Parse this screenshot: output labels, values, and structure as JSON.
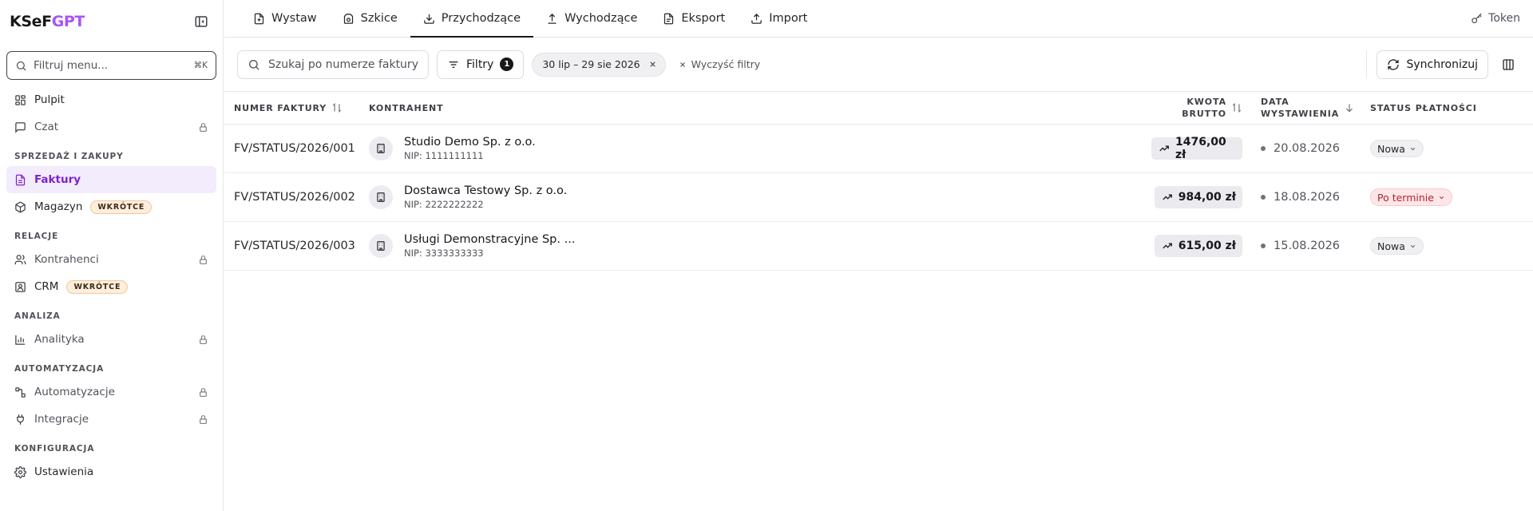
{
  "app": {
    "logo_part1": "KSeF",
    "logo_part2": "GPT"
  },
  "sidebar": {
    "filter_placeholder": "Filtruj menu...",
    "filter_shortcut": "⌘K",
    "items": [
      {
        "label": "Pulpit",
        "icon": "dashboard-icon"
      },
      {
        "label": "Czat",
        "icon": "chat-icon",
        "locked": true
      },
      {
        "label": "Faktury",
        "icon": "invoice-icon",
        "active": true
      },
      {
        "label": "Magazyn",
        "icon": "box-icon",
        "badge": "WKRÓTCE"
      },
      {
        "label": "Kontrahenci",
        "icon": "users-icon",
        "locked": true
      },
      {
        "label": "CRM",
        "icon": "contact-icon",
        "badge": "WKRÓTCE"
      },
      {
        "label": "Analityka",
        "icon": "chart-icon",
        "locked": true
      },
      {
        "label": "Automatyzacje",
        "icon": "workflow-icon",
        "locked": true
      },
      {
        "label": "Integracje",
        "icon": "plug-icon",
        "locked": true
      },
      {
        "label": "Ustawienia",
        "icon": "gear-icon"
      }
    ],
    "sections": [
      "SPRZEDAŻ I ZAKUPY",
      "RELACJE",
      "ANALIZA",
      "AUTOMATYZACJA",
      "KONFIGURACJA"
    ]
  },
  "tabs": [
    {
      "label": "Wystaw",
      "icon": "file-plus-icon"
    },
    {
      "label": "Szkice",
      "icon": "draft-icon"
    },
    {
      "label": "Przychodzące",
      "icon": "download-icon",
      "active": true
    },
    {
      "label": "Wychodzące",
      "icon": "upload-icon"
    },
    {
      "label": "Eksport",
      "icon": "file-text-icon"
    },
    {
      "label": "Import",
      "icon": "import-icon"
    }
  ],
  "token_label": "Token",
  "toolbar": {
    "search_placeholder": "Szukaj po numerze faktury",
    "filters_label": "Filtry",
    "filters_count": "1",
    "date_chip": "30 lip – 29 sie 2026",
    "clear_label": "Wyczyść filtry",
    "sync_label": "Synchronizuj"
  },
  "table": {
    "headers": {
      "number": "NUMER FAKTURY",
      "party": "KONTRAHENT",
      "amount_line1": "KWOTA",
      "amount_line2": "BRUTTO",
      "date_line1": "DATA",
      "date_line2": "WYSTAWIENIA",
      "status": "STATUS PŁATNOŚCI"
    },
    "rows": [
      {
        "number": "FV/STATUS/2026/001",
        "party": "Studio Demo Sp. z o.o.",
        "nip": "NIP: 1111111111",
        "amount": "1476,00 zł",
        "date": "20.08.2026",
        "status": "Nowa"
      },
      {
        "number": "FV/STATUS/2026/002",
        "party": "Dostawca Testowy Sp. z o.o.",
        "nip": "NIP: 2222222222",
        "amount": "984,00 zł",
        "date": "18.08.2026",
        "status": "Po terminie"
      },
      {
        "number": "FV/STATUS/2026/003",
        "party": "Usługi Demonstracyjne Sp. ...",
        "nip": "NIP: 3333333333",
        "amount": "615,00 zł",
        "date": "15.08.2026",
        "status": "Nowa"
      }
    ]
  },
  "colors": {
    "accent": "#a855f7",
    "active_bg": "#f3ecfd",
    "active_text": "#7e22ce",
    "late_bg": "#fde6e8",
    "late_text": "#b4232c"
  }
}
